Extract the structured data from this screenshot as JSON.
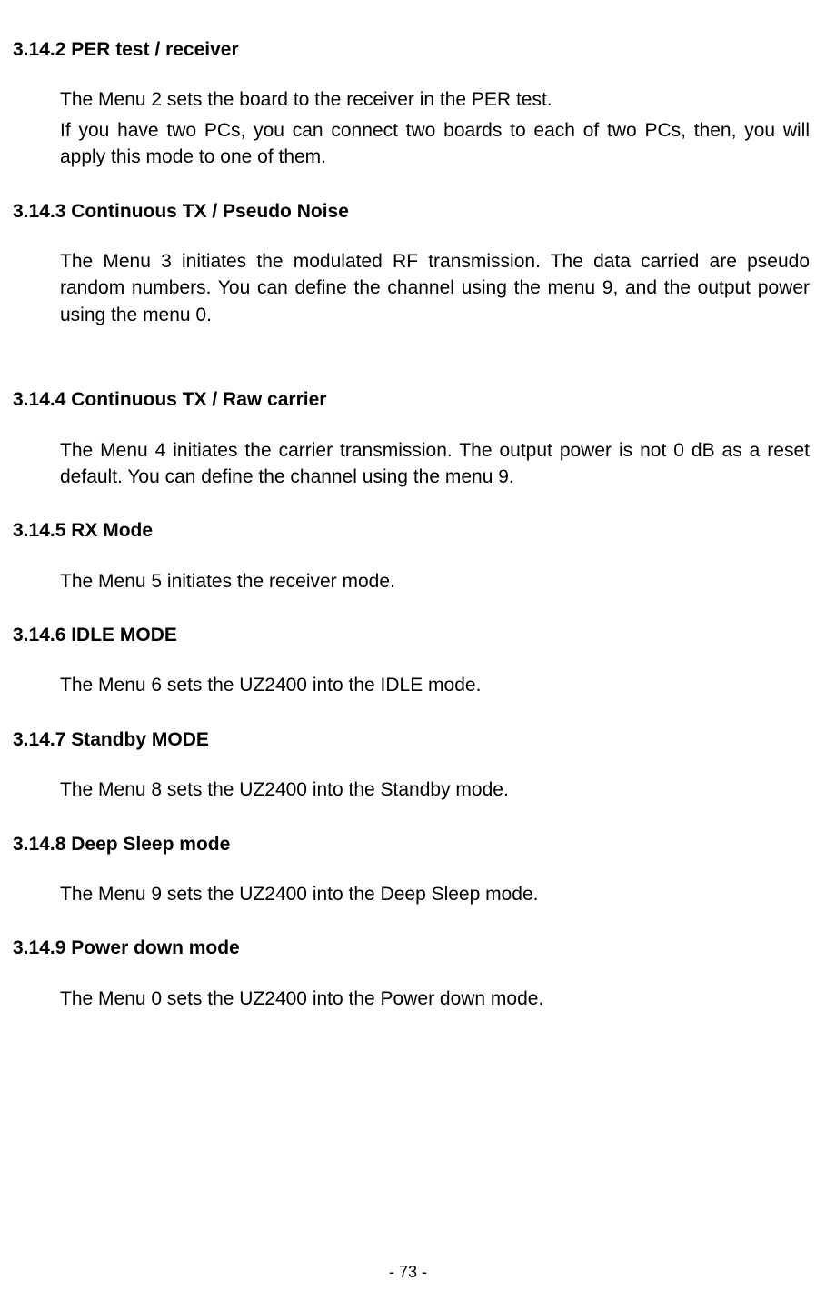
{
  "sections": {
    "s1": {
      "heading": "3.14.2 PER test / receiver",
      "para1": "The Menu 2 sets the board to the receiver in the PER test.",
      "para2": "If you have two PCs, you can connect two boards to each of two PCs, then, you will apply this mode to one of them."
    },
    "s2": {
      "heading": "3.14.3 Continuous TX / Pseudo Noise",
      "para1": "The Menu 3 initiates the modulated RF transmission. The data carried are pseudo random numbers. You can define the channel using the menu 9, and the output power using the menu 0."
    },
    "s3": {
      "heading": "3.14.4   Continuous TX / Raw carrier",
      "para1": "The Menu 4 initiates the carrier transmission. The output power is not 0 dB as a reset default. You can define the channel using the menu 9."
    },
    "s4": {
      "heading": "3.14.5 RX Mode",
      "para1": "The Menu 5 initiates the receiver mode."
    },
    "s5": {
      "heading": "3.14.6 IDLE MODE",
      "para1": "The Menu 6 sets the UZ2400 into the IDLE mode."
    },
    "s6": {
      "heading": "3.14.7 Standby MODE",
      "para1": "The Menu 8 sets the UZ2400 into the Standby mode."
    },
    "s7": {
      "heading": "3.14.8 Deep Sleep mode",
      "para1": "The Menu 9 sets the UZ2400 into the Deep Sleep mode."
    },
    "s8": {
      "heading": "3.14.9 Power down mode",
      "para1": "The Menu 0 sets the UZ2400 into the Power down mode."
    }
  },
  "page_number": "- 73 -"
}
